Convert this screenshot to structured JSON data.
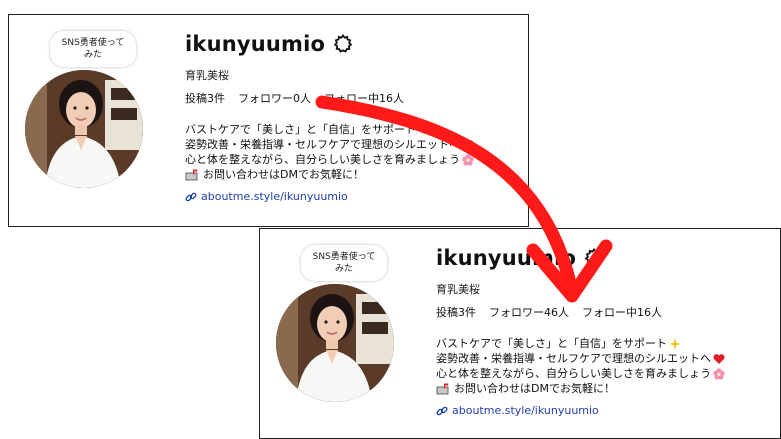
{
  "profiles": [
    {
      "bubble_line1": "SNS勇者使って",
      "bubble_line2": "みた",
      "username": "ikunyuumio",
      "display_name": "育乳美桜",
      "posts": "投稿3件",
      "followers": "フォロワー0人",
      "following": "フォロー中16人",
      "bio_line1": "バストケアで「美しさ」と「自信」をサポート",
      "bio_line2": "姿勢改善・栄養指導・セルフケアで理想のシルエットへ",
      "bio_line3": "心と体を整えながら、自分らしい美しさを育みましょう",
      "bio_line4": "お問い合わせはDMでお気軽に！",
      "link": "aboutme.style/ikunyuumio"
    },
    {
      "bubble_line1": "SNS勇者使って",
      "bubble_line2": "みた",
      "username": "ikunyuumio",
      "display_name": "育乳美桜",
      "posts": "投稿3件",
      "followers": "フォロワー46人",
      "following": "フォロー中16人",
      "bio_line1": "バストケアで「美しさ」と「自信」をサポート",
      "bio_line2": "姿勢改善・栄養指導・セルフケアで理想のシルエットへ",
      "bio_line3": "心と体を整えながら、自分らしい美しさを育みましょう",
      "bio_line4": "お問い合わせはDMでお気軽に！",
      "link": "aboutme.style/ikunyuumio"
    }
  ],
  "icons": {
    "verified": "gear-badge-icon",
    "sparkle": "sparkle-icon",
    "heart": "red-heart-icon",
    "flower": "pink-flower-icon",
    "mailbox": "mailbox-icon",
    "link": "link-icon",
    "arrow": "red-curved-arrow"
  },
  "colors": {
    "arrow": "#ff1a1a",
    "link": "#1f3fa8",
    "text": "#111111"
  }
}
